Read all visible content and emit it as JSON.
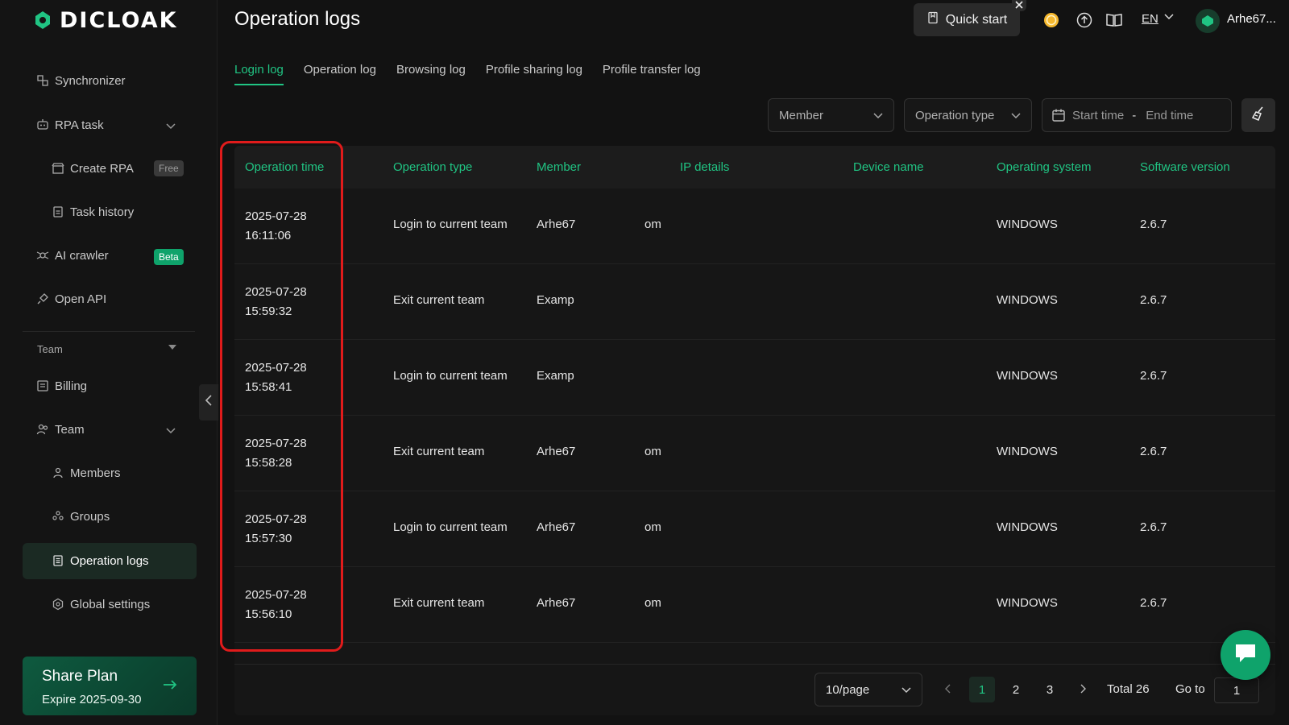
{
  "brand": {
    "name": "DICLOAK"
  },
  "sidebar": {
    "items": [
      {
        "label": "Synchronizer"
      },
      {
        "label": "RPA task"
      },
      {
        "label": "Create RPA",
        "badge": "Free"
      },
      {
        "label": "Task history"
      },
      {
        "label": "AI crawler",
        "badge": "Beta"
      },
      {
        "label": "Open API"
      },
      {
        "label": "Billing"
      },
      {
        "label": "Team"
      },
      {
        "label": "Members"
      },
      {
        "label": "Groups"
      },
      {
        "label": "Operation logs"
      },
      {
        "label": "Global settings"
      }
    ],
    "section_label": "Team",
    "share_plan": {
      "title": "Share Plan",
      "expire": "Expire 2025-09-30"
    }
  },
  "header": {
    "title": "Operation logs",
    "quick_start": "Quick start",
    "language": "EN",
    "username": "Arhe67..."
  },
  "tabs": [
    "Login log",
    "Operation log",
    "Browsing log",
    "Profile sharing log",
    "Profile transfer log"
  ],
  "filters": {
    "member": "Member",
    "operation_type": "Operation type",
    "start_time": "Start time",
    "separator": "-",
    "end_time": "End time"
  },
  "table": {
    "columns": [
      "Operation time",
      "Operation type",
      "Member",
      "IP details",
      "Device name",
      "Operating system",
      "Software version"
    ],
    "rows": [
      {
        "date": "2025-07-28",
        "time": "16:11:06",
        "type": "Login to current team",
        "member": "Arhe67",
        "ip": "om",
        "os": "WINDOWS",
        "version": "2.6.7"
      },
      {
        "date": "2025-07-28",
        "time": "15:59:32",
        "type": "Exit current team",
        "member": "Examp",
        "ip": "",
        "os": "WINDOWS",
        "version": "2.6.7"
      },
      {
        "date": "2025-07-28",
        "time": "15:58:41",
        "type": "Login to current team",
        "member": "Examp",
        "ip": "",
        "os": "WINDOWS",
        "version": "2.6.7"
      },
      {
        "date": "2025-07-28",
        "time": "15:58:28",
        "type": "Exit current team",
        "member": "Arhe67",
        "ip": "om",
        "os": "WINDOWS",
        "version": "2.6.7"
      },
      {
        "date": "2025-07-28",
        "time": "15:57:30",
        "type": "Login to current team",
        "member": "Arhe67",
        "ip": "om",
        "os": "WINDOWS",
        "version": "2.6.7"
      },
      {
        "date": "2025-07-28",
        "time": "15:56:10",
        "type": "Exit current team",
        "member": "Arhe67",
        "ip": "om",
        "os": "WINDOWS",
        "version": "2.6.7"
      }
    ]
  },
  "pagination": {
    "page_size": "10/page",
    "pages": [
      "1",
      "2",
      "3"
    ],
    "current": "1",
    "total": "Total 26",
    "goto_label": "Go to",
    "goto_value": "1"
  },
  "colors": {
    "accent": "#20c483",
    "highlight": "#e01b1b",
    "background": "#121212"
  }
}
